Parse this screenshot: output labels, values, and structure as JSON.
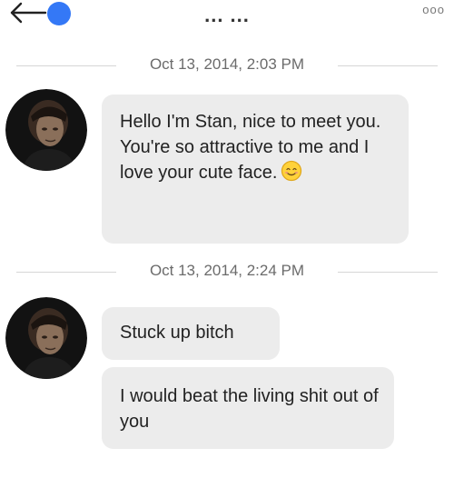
{
  "header": {
    "title": "... ...",
    "more_label": "ooo"
  },
  "conversation": {
    "groups": [
      {
        "timestamp": "Oct 13, 2014, 2:03 PM",
        "messages": [
          {
            "text": "Hello I'm Stan, nice to meet you. You're so attractive to me and I love your cute face.",
            "emoji": "smiling-face-emoji"
          }
        ]
      },
      {
        "timestamp": "Oct 13, 2014, 2:24 PM",
        "messages": [
          {
            "text": "Stuck up bitch"
          },
          {
            "text": "I would beat the living shit out of you"
          }
        ]
      }
    ]
  },
  "icons": {
    "back": "back-arrow-icon",
    "status_dot": "status-dot-icon",
    "more": "more-options-icon",
    "avatar": "avatar-photo"
  },
  "colors": {
    "accent_blue": "#3478f6",
    "bubble_gray": "#ececec",
    "separator": "#d6d6d6",
    "timestamp_text": "#6b6b6b"
  }
}
